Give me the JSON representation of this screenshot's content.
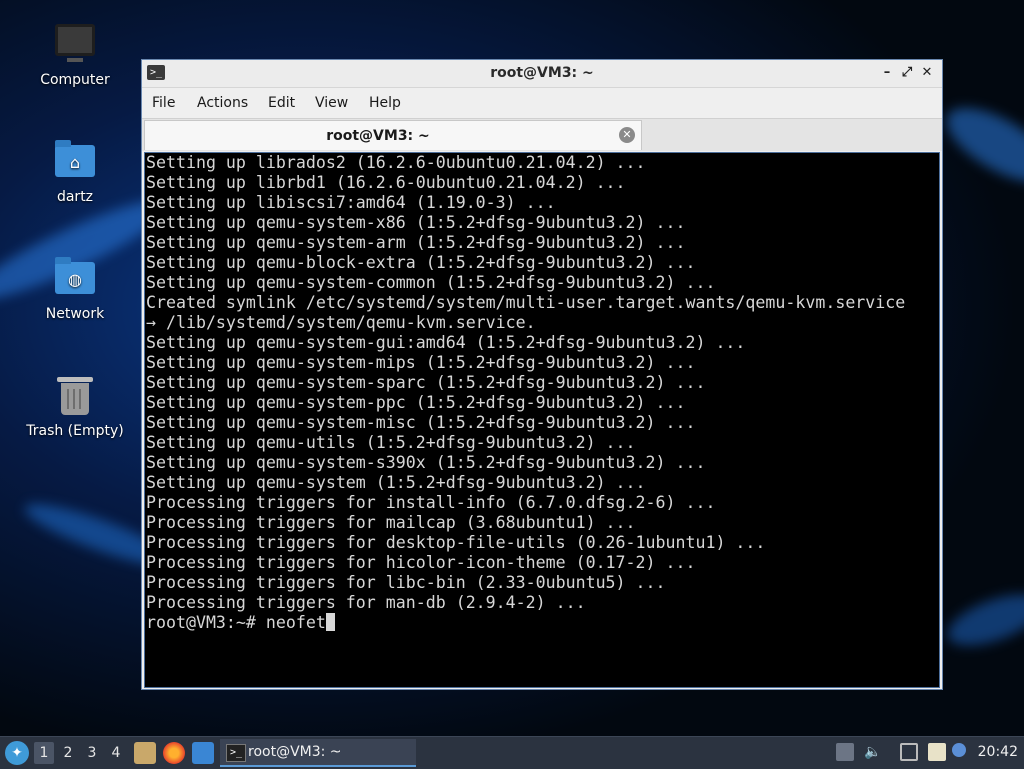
{
  "desktop": {
    "icons": [
      {
        "label": "Computer",
        "icon": "computer-icon"
      },
      {
        "label": "dartz",
        "icon": "home-folder-icon"
      },
      {
        "label": "Network",
        "icon": "network-folder-icon"
      },
      {
        "label": "Trash (Empty)",
        "icon": "trash-icon"
      }
    ]
  },
  "window": {
    "title": "root@VM3: ~",
    "controls": {
      "minimize": "–",
      "maximize": "⤢",
      "close": "✕"
    },
    "menu": [
      "File",
      "Actions",
      "Edit",
      "View",
      "Help"
    ],
    "tab": {
      "label": "root@VM3: ~",
      "close": "✕"
    }
  },
  "terminal": {
    "lines": [
      "Setting up librados2 (16.2.6-0ubuntu0.21.04.2) ...",
      "Setting up librbd1 (16.2.6-0ubuntu0.21.04.2) ...",
      "Setting up libiscsi7:amd64 (1.19.0-3) ...",
      "Setting up qemu-system-x86 (1:5.2+dfsg-9ubuntu3.2) ...",
      "Setting up qemu-system-arm (1:5.2+dfsg-9ubuntu3.2) ...",
      "Setting up qemu-block-extra (1:5.2+dfsg-9ubuntu3.2) ...",
      "Setting up qemu-system-common (1:5.2+dfsg-9ubuntu3.2) ...",
      "Created symlink /etc/systemd/system/multi-user.target.wants/qemu-kvm.service",
      "→ /lib/systemd/system/qemu-kvm.service.",
      "Setting up qemu-system-gui:amd64 (1:5.2+dfsg-9ubuntu3.2) ...",
      "Setting up qemu-system-mips (1:5.2+dfsg-9ubuntu3.2) ...",
      "Setting up qemu-system-sparc (1:5.2+dfsg-9ubuntu3.2) ...",
      "Setting up qemu-system-ppc (1:5.2+dfsg-9ubuntu3.2) ...",
      "Setting up qemu-system-misc (1:5.2+dfsg-9ubuntu3.2) ...",
      "Setting up qemu-utils (1:5.2+dfsg-9ubuntu3.2) ...",
      "Setting up qemu-system-s390x (1:5.2+dfsg-9ubuntu3.2) ...",
      "Setting up qemu-system (1:5.2+dfsg-9ubuntu3.2) ...",
      "Processing triggers for install-info (6.7.0.dfsg.2-6) ...",
      "Processing triggers for mailcap (3.68ubuntu1) ...",
      "Processing triggers for desktop-file-utils (0.26-1ubuntu1) ...",
      "Processing triggers for hicolor-icon-theme (0.17-2) ...",
      "Processing triggers for libc-bin (2.33-0ubuntu5) ...",
      "Processing triggers for man-db (2.9.4-2) ..."
    ],
    "prompt": "root@VM3:~# neofet"
  },
  "taskbar": {
    "workspaces": [
      "1",
      "2",
      "3",
      "4"
    ],
    "active_workspace": "1",
    "task": {
      "label": "root@VM3: ~"
    },
    "clock": "20:42"
  },
  "colors": {
    "terminal_bg": "#000000",
    "terminal_fg": "#d7d7d7",
    "window_border": "#6a88b0",
    "taskbar_bg": "#2b3340"
  }
}
